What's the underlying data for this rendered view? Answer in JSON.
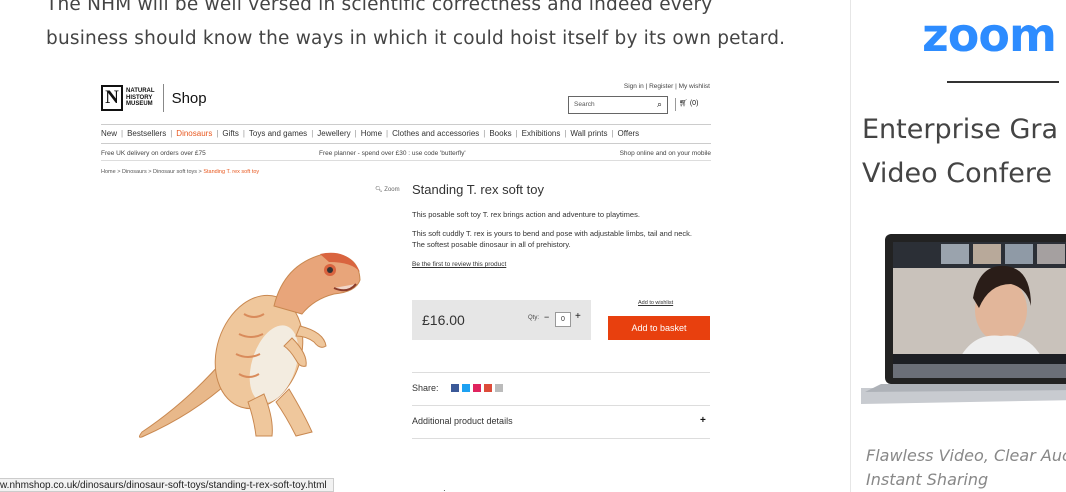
{
  "article": {
    "intro_line1": "The NHM will be well versed in scientific correctness and indeed every",
    "intro_line2": "business should know the ways in which it could hoist itself by its own petard."
  },
  "shop": {
    "logo_letter": "N",
    "logo_words": [
      "NATURAL",
      "HISTORY",
      "MUSEUM"
    ],
    "logo_shop": "Shop",
    "top_links": "Sign in  |  Register  |  My wishlist",
    "search_placeholder": "Search",
    "basket_count": "(0)",
    "nav": [
      "New",
      "Bestsellers",
      "Dinosaurs",
      "Gifts",
      "Toys and games",
      "Jewellery",
      "Home",
      "Clothes and accessories",
      "Books",
      "Exhibitions",
      "Wall prints",
      "Offers"
    ],
    "nav_active": "Dinosaurs",
    "promo_left": "Free UK delivery on orders over £75",
    "promo_mid": "Free planner - spend over £30 : use code 'butterfly'",
    "promo_right": "Shop online and on your mobile",
    "breadcrumbs": [
      "Home",
      "Dinosaurs",
      "Dinosaur soft toys"
    ],
    "breadcrumb_current": "Standing T. rex soft toy",
    "zoom_label": "Zoom",
    "product_title": "Standing T. rex soft toy",
    "desc1": "This posable soft toy T. rex brings action and adventure to playtimes.",
    "desc2": "This soft cuddly T. rex is yours to bend and pose with adjustable limbs, tail and neck. The softest posable dinosaur in all of prehistory.",
    "review_link": "Be the first to review this product",
    "price": "£16.00",
    "qty_label": "Qty:",
    "qty_value": "0",
    "wishlist_link": "Add to wishlist",
    "add_basket": "Add to basket",
    "share_label": "Share:",
    "share_colors": [
      "#3b5998",
      "#1da1f2",
      "#e0245e",
      "#dd4b39",
      "#bbbbbb"
    ],
    "details_label": "Additional product details"
  },
  "status_url": "w.nhmshop.co.uk/dinosaurs/dinosaur-soft-toys/standing-t-rex-soft-toy.html",
  "ad": {
    "logo": "zoom",
    "headline1": "Enterprise Gra",
    "headline2": "Video Confere",
    "tagline1": "Flawless Video, Clear Auc",
    "tagline2": "Instant Sharing",
    "brand_color": "#2d8cff"
  }
}
